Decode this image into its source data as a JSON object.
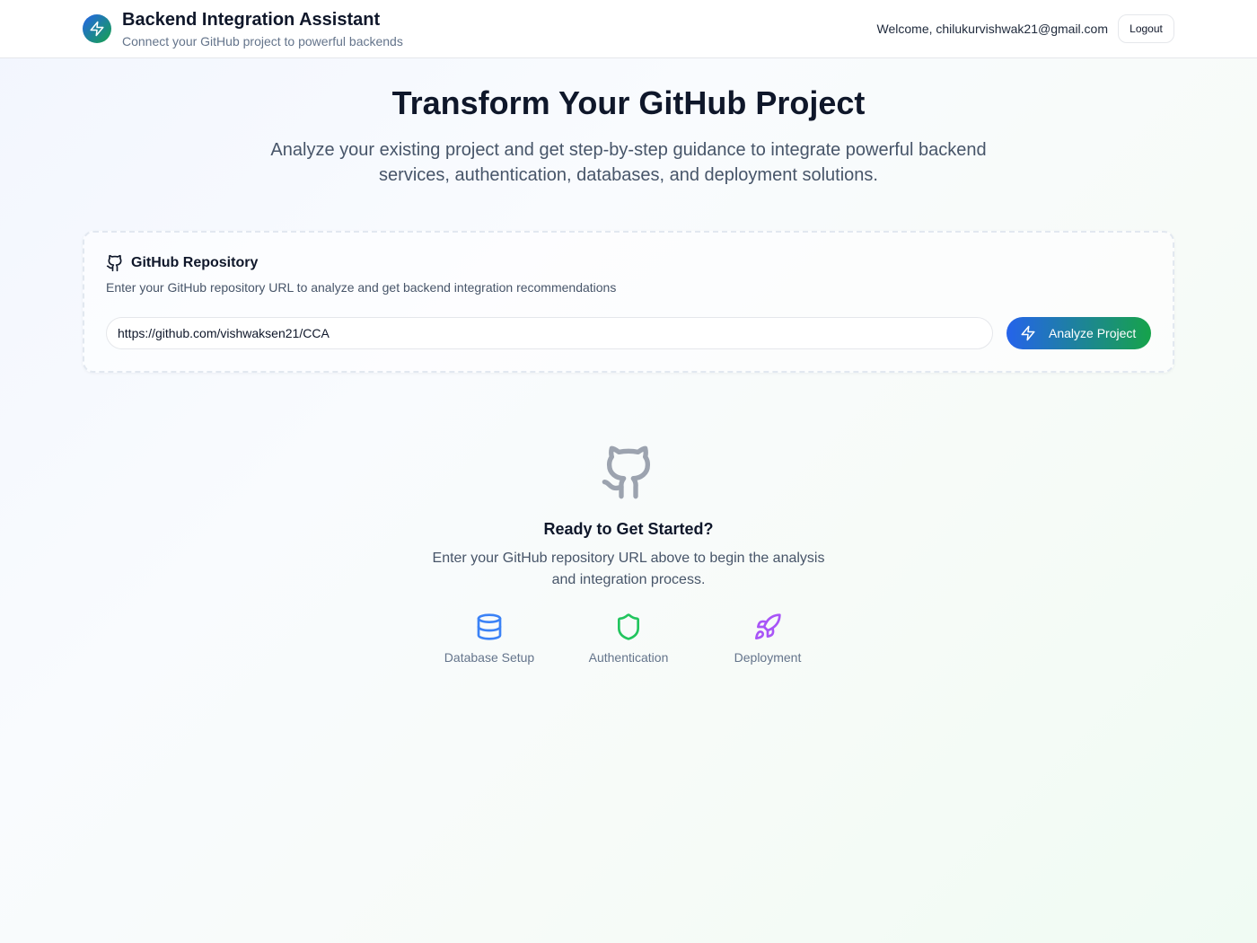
{
  "header": {
    "title": "Backend Integration Assistant",
    "subtitle": "Connect your GitHub project to powerful backends",
    "logo_icon": "zap-icon",
    "welcome_text": "Welcome, chilukurvishwak21@gmail.com",
    "logout_label": "Logout"
  },
  "hero": {
    "title": "Transform Your GitHub Project",
    "description": "Analyze your existing project and get step-by-step guidance to integrate powerful backend services, authentication, databases, and deployment solutions."
  },
  "repo_card": {
    "icon": "github-icon",
    "title": "GitHub Repository",
    "description": "Enter your GitHub repository URL to analyze and get backend integration recommendations",
    "url_value": "https://github.com/vishwaksen21/CCA",
    "analyze_label": "Analyze Project",
    "analyze_icon": "zap-icon"
  },
  "empty_state": {
    "icon": "github-icon",
    "title": "Ready to Get Started?",
    "description": "Enter your GitHub repository URL above to begin the analysis and integration process.",
    "features": [
      {
        "label": "Database Setup",
        "icon": "database-icon",
        "color": "#3b82f6"
      },
      {
        "label": "Authentication",
        "icon": "shield-icon",
        "color": "#22c55e"
      },
      {
        "label": "Deployment",
        "icon": "rocket-icon",
        "color": "#a855f7"
      }
    ]
  },
  "colors": {
    "brand_gradient_start": "#2563eb",
    "brand_gradient_end": "#16a34a",
    "text_primary": "#0f172a",
    "text_muted": "#64748b"
  }
}
